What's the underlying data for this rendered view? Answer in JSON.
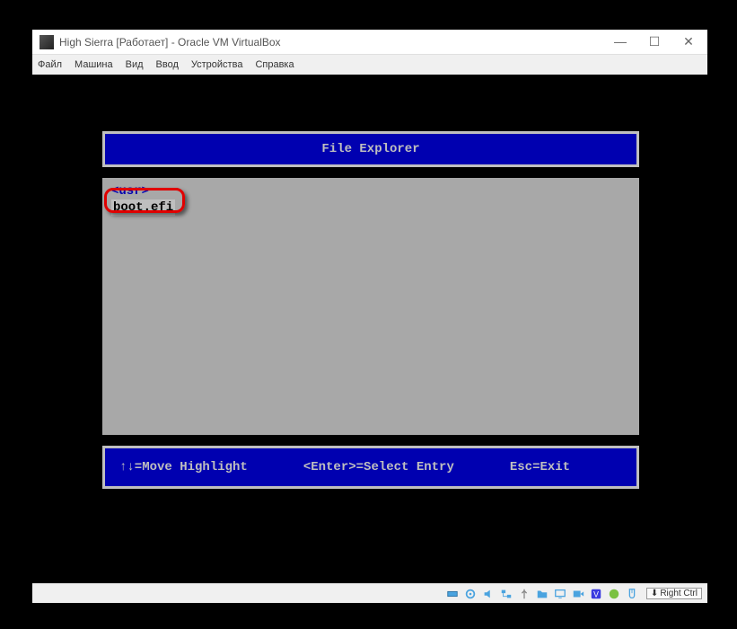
{
  "window": {
    "title": "High Sierra [Работает] - Oracle VM VirtualBox",
    "controls": {
      "min": "—",
      "max": "☐",
      "close": "✕"
    }
  },
  "menu": {
    "file": "Файл",
    "machine": "Машина",
    "view": "Вид",
    "input": "Ввод",
    "devices": "Устройства",
    "help": "Справка"
  },
  "efi": {
    "title": "File Explorer",
    "entry_usr": "<usr>",
    "entry_boot": "boot.efi",
    "hint_move": "↑↓=Move Highlight",
    "hint_select": "<Enter>=Select Entry",
    "hint_exit": "Esc=Exit"
  },
  "status": {
    "host_key": "Right Ctrl"
  },
  "colors": {
    "efi_blue": "#0000b0",
    "efi_gray": "#a8a8a8",
    "efi_light": "#bfbfbf",
    "highlight": "#e00000"
  }
}
